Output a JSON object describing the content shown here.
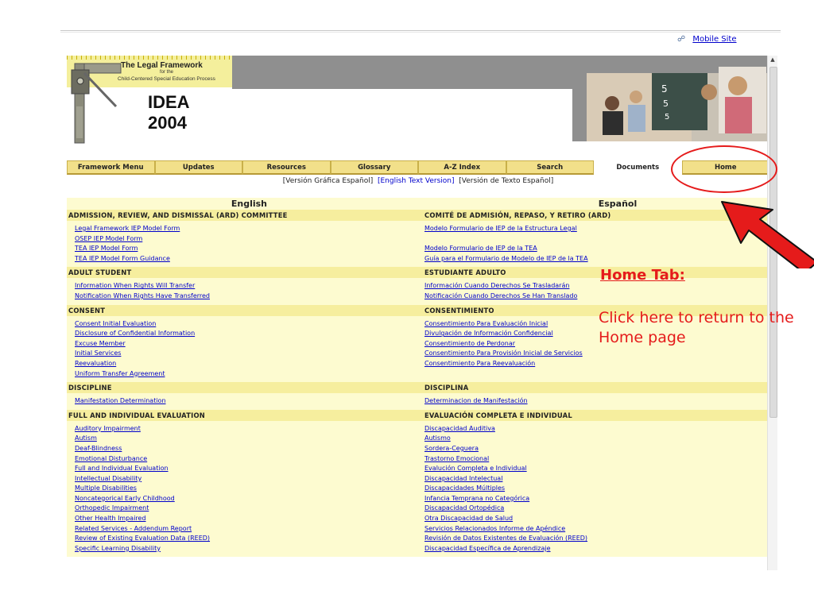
{
  "header": {
    "mobile_link": "Mobile Site",
    "logo_title": "The Legal Framework",
    "logo_for": "for the",
    "logo_subtitle": "Child-Centered Special Education Process",
    "logo_idea": "IDEA",
    "logo_year": "2004"
  },
  "nav": {
    "tabs": [
      "Framework Menu",
      "Updates",
      "Resources",
      "Glossary",
      "A-Z Index",
      "Search",
      "Documents",
      "Home"
    ],
    "active": "Documents"
  },
  "version_line": {
    "graphic_es": "[Versión Gráfica Español]",
    "text_en": "[English Text Version]",
    "text_es": "[Versión de Texto Español]"
  },
  "languages": {
    "left": "English",
    "right": "Español"
  },
  "sections": [
    {
      "en": "ADMISSION, REVIEW, AND DISMISSAL (ARD) COMMITTEE",
      "es": "COMITÉ DE ADMISIÓN, REPASO, Y RETIRO (ARD)",
      "items": [
        {
          "en": "Legal Framework IEP Model Form",
          "es": "Modelo Formulario de IEP de la Estructura Legal"
        },
        {
          "en": "OSEP IEP Model Form",
          "es": ""
        },
        {
          "en": "TEA IEP Model Form",
          "es": "Modelo Formulario de IEP de la TEA"
        },
        {
          "en": "TEA IEP Model Form Guidance",
          "es": "Guía para el Formulario de Modelo de IEP de la TEA"
        }
      ]
    },
    {
      "en": "ADULT STUDENT",
      "es": "ESTUDIANTE ADULTO",
      "items": [
        {
          "en": "Information When Rights Will Transfer",
          "es": "Información Cuando Derechos Se Trasladarán"
        },
        {
          "en": "Notification When Rights Have Transferred",
          "es": "Notificación Cuando Derechos Se Han Translado"
        }
      ]
    },
    {
      "en": "CONSENT",
      "es": "CONSENTIMIENTO",
      "items": [
        {
          "en": "Consent Initial Evaluation",
          "es": "Consentimiento Para Evaluación Inicial"
        },
        {
          "en": "Disclosure of Confidential Information",
          "es": "Divulgación de Información Confidencial"
        },
        {
          "en": "Excuse Member",
          "es": "Consentimiento de Perdonar"
        },
        {
          "en": "Initial Services",
          "es": "Consentimiento Para Provisión Inicial de Servicios"
        },
        {
          "en": "Reevaluation",
          "es": "Consentimiento Para Reevaluación"
        },
        {
          "en": "Uniform Transfer Agreement",
          "es": ""
        }
      ]
    },
    {
      "en": "DISCIPLINE",
      "es": "DISCIPLINA",
      "items": [
        {
          "en": "Manifestation Determination",
          "es": "Determinacion de Manifestación"
        }
      ]
    },
    {
      "en": "FULL AND INDIVIDUAL EVALUATION",
      "es": "EVALUACIÓN COMPLETA E INDIVIDUAL",
      "items": [
        {
          "en": "Auditory Impairment",
          "es": "Discapacidad Auditiva"
        },
        {
          "en": "Autism",
          "es": "Autismo"
        },
        {
          "en": "Deaf-Blindness",
          "es": "Sordera-Ceguera"
        },
        {
          "en": "Emotional Disturbance",
          "es": "Trastorno Emocional"
        },
        {
          "en": "Full and Individual Evaluation",
          "es": "Evalución Completa e Individual"
        },
        {
          "en": "Intellectual Disability",
          "es": "Discapacidad Intelectual"
        },
        {
          "en": "Multiple Disabilities",
          "es": "Discapacidades Múltiples"
        },
        {
          "en": "Noncategorical Early Childhood",
          "es": "Infancia Temprana no Categórica"
        },
        {
          "en": "Orthopedic Impairment",
          "es": "Discapacidad Ortopédica"
        },
        {
          "en": "Other Health Impaired",
          "es": "Otra Discapacidad de Salud"
        },
        {
          "en": "Related Services - Addendum Report",
          "es": "Servicios Relacionados Informe de Apéndice"
        },
        {
          "en": "Review of Existing Evaluation Data (REED)",
          "es": "Revisión de Datos Existentes de Evaluación (REED)"
        },
        {
          "en": "Specific Learning Disability",
          "es": "Discapacidad Específica de Aprendizaje"
        }
      ]
    }
  ],
  "annotation": {
    "title": "Home Tab:",
    "text": "Click here to return to the Home page"
  },
  "colors": {
    "accent_red": "#e51b1b",
    "section_bg": "#f6ee9e",
    "row_bg": "#fdfbd0",
    "tab_bg": "#f2e08a",
    "link": "#0000cc"
  },
  "icons": [
    "mobile-phone-icon",
    "carpenter-square-logo-icon",
    "red-arrow-icon"
  ]
}
